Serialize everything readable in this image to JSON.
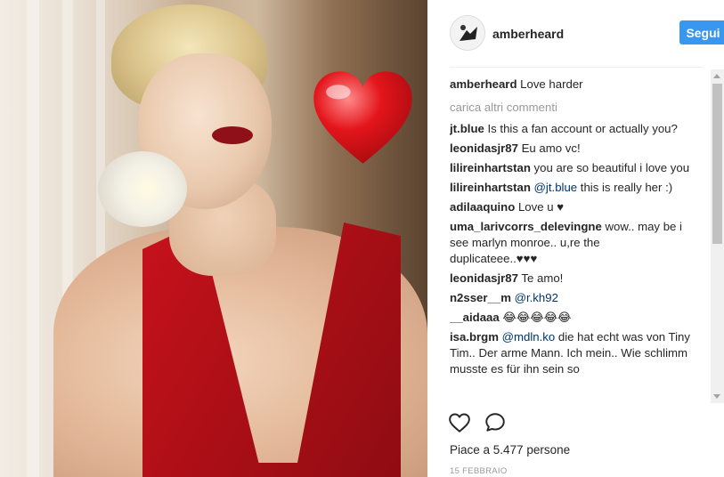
{
  "post": {
    "username": "amberheard",
    "follow_label": "Segui",
    "caption_user": "amberheard",
    "caption_text": "Love harder",
    "load_more": "carica altri commenti",
    "comments": [
      {
        "user": "jt.blue",
        "text": "Is this a fan account or actually you?"
      },
      {
        "user": "leonidasjr87",
        "text": "Eu amo vc!"
      },
      {
        "user": "lilireinhartstan",
        "text": "you are so beautiful i love you"
      },
      {
        "user": "lilireinhartstan",
        "mention": "@jt.blue",
        "text": " this is really her :)"
      },
      {
        "user": "adilaaquino",
        "text": "Love u ♥"
      },
      {
        "user": "uma_larivcorrs_delevingne",
        "text": "wow.. may be i see marlyn monroe.. u,re the duplicateee..♥♥♥"
      },
      {
        "user": "leonidasjr87",
        "text": "Te amo!"
      },
      {
        "user": "n2sser__m",
        "mention": "@r.kh92",
        "text": ""
      },
      {
        "user": "__aidaaa",
        "text": "😂😂😂😂😂"
      },
      {
        "user": "isa.brgm",
        "mention": "@mdln.ko",
        "text": " die hat echt was von Tiny Tim.. Der arme Mann. Ich mein.. Wie schlimm musste es für ihn sein so"
      }
    ],
    "likes": "Piace a 5.477 persone",
    "date": "15 FEBBRAIO"
  },
  "colors": {
    "follow_bg": "#3897f0",
    "mention": "#003569",
    "muted": "#999999"
  },
  "icons": [
    "heart-outline-icon",
    "comment-icon"
  ]
}
